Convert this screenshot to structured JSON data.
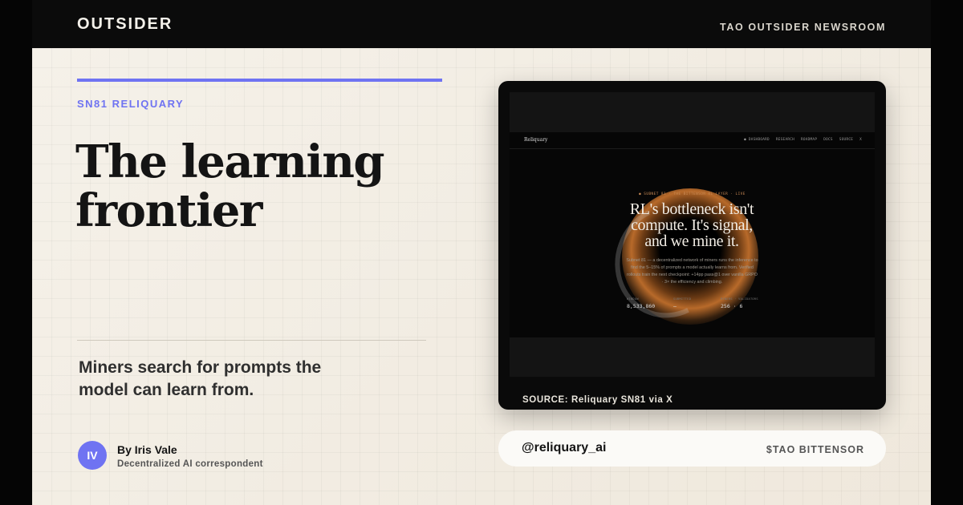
{
  "header": {
    "brand": "OUTSIDER",
    "newsroom": "TAO OUTSIDER NEWSROOM"
  },
  "article": {
    "kicker": "SN81 RELIQUARY",
    "headline": "The learning frontier",
    "dek": "Miners search for prompts the model can learn from.",
    "author": {
      "initials": "IV",
      "byline": "By Iris Vale",
      "role": "Decentralized AI correspondent"
    }
  },
  "colors": {
    "accent": "#6f73f2",
    "background": "#f2ede3",
    "topbar": "#0b0b0b"
  },
  "embedded_screenshot": {
    "logo": "Reliquary",
    "nav_links": [
      "● DASHBOARD",
      "RESEARCH",
      "ROADMAP",
      "DOCS",
      "SOURCE",
      "X"
    ],
    "eyebrow": "● SUBNET 81 · THE BITTENSOR RL LAYER · LIVE",
    "title": "RL's bottleneck isn't compute. It's signal, and we mine it.",
    "body": "Subnet 81 — a decentralized network of miners runs the inference to find the 5–15% of prompts a model actually learns from. Verified rollouts train the next checkpoint: +14pp pass@1 over vanilla GRPO · 3× the efficiency and climbing.",
    "stats": [
      {
        "label": "WINDOW",
        "value": "8,533,860"
      },
      {
        "label": "SUBMITTED",
        "value": "—"
      },
      {
        "label": "MINERS · VALIDATORS",
        "value": "256 · 6"
      }
    ]
  },
  "source": "SOURCE: Reliquary SN81 via X",
  "footer": {
    "handle": "@reliquary_ai",
    "tag": "$TAO BITTENSOR"
  }
}
